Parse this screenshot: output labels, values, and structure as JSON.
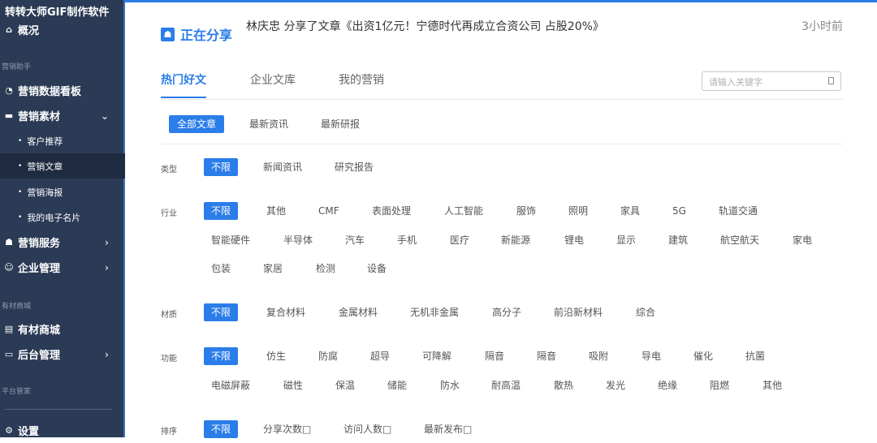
{
  "sidebar": {
    "brand": "转转大师GIF制作软件",
    "overview": "概况",
    "group_marketing": "营销助手",
    "data_board": "营销数据看板",
    "materials": "营销素材",
    "sub_items": [
      "客户推荐",
      "营销文章",
      "营销海报",
      "我的电子名片"
    ],
    "services": "营销服务",
    "enterprise": "企业管理",
    "group_mall": "有材商城",
    "mall": "有材商城",
    "backend": "后台管理",
    "group_platform": "平台管家",
    "settings": "设置"
  },
  "share": {
    "label": "正在分享",
    "text": "林庆忠  分享了文章《出资1亿元！宁德时代再成立合资公司 占股20%》",
    "time": "3小时前"
  },
  "tabs": [
    "热门好文",
    "企业文库",
    "我的营销"
  ],
  "search": {
    "placeholder": "请输入关键字"
  },
  "subtabs": [
    "全部文章",
    "最新资讯",
    "最新研报"
  ],
  "filters": {
    "type": {
      "label": "类型",
      "options": [
        "不限",
        "新闻资讯",
        "研究报告"
      ]
    },
    "industry": {
      "label": "行业",
      "row1": [
        "不限",
        "其他",
        "CMF",
        "表面处理",
        "人工智能",
        "服饰",
        "照明",
        "家具",
        "5G",
        "轨道交通"
      ],
      "row2": [
        "智能硬件",
        "半导体",
        "汽车",
        "手机",
        "医疗",
        "新能源",
        "锂电",
        "显示",
        "建筑",
        "航空航天",
        "家电"
      ],
      "row3": [
        "包装",
        "家居",
        "检测",
        "设备"
      ]
    },
    "material": {
      "label": "材质",
      "options": [
        "不限",
        "复合材料",
        "金属材料",
        "无机非金属",
        "高分子",
        "前沿新材料",
        "综合"
      ]
    },
    "function": {
      "label": "功能",
      "row1": [
        "不限",
        "仿生",
        "防腐",
        "超导",
        "可降解",
        "隔音",
        "隔音",
        "吸附",
        "导电",
        "催化",
        "抗菌"
      ],
      "row2": [
        "电磁屏蔽",
        "磁性",
        "保温",
        "储能",
        "防水",
        "耐高温",
        "散热",
        "发光",
        "绝缘",
        "阻燃",
        "其他"
      ]
    },
    "sort": {
      "label": "排序",
      "options": [
        "不限",
        "分享次数□",
        "访问人数□",
        "最新发布□"
      ]
    }
  },
  "colors": {
    "accent": "#2b7de9",
    "sidebar": "#2b3a55"
  }
}
